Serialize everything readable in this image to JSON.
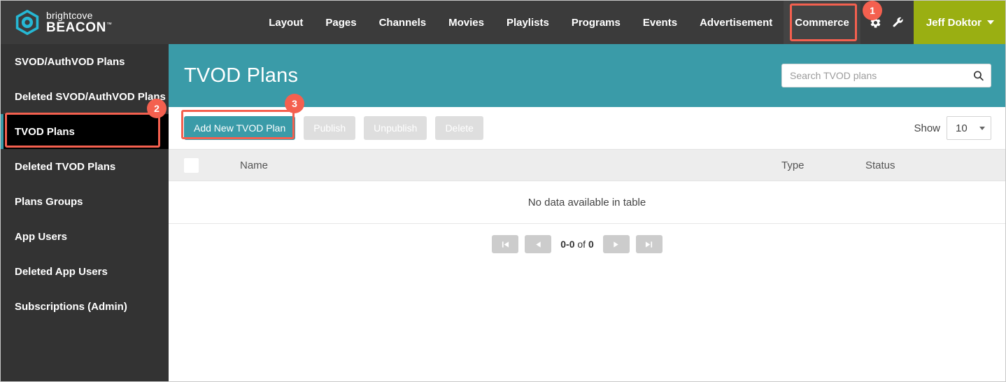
{
  "brand": {
    "top": "brightcove",
    "bottom": "BEACON",
    "trademark": "™",
    "logo_icon": "brightcove-hexagon-logo"
  },
  "topnav": {
    "items": [
      {
        "label": "Layout",
        "name": "nav-layout"
      },
      {
        "label": "Pages",
        "name": "nav-pages"
      },
      {
        "label": "Channels",
        "name": "nav-channels"
      },
      {
        "label": "Movies",
        "name": "nav-movies"
      },
      {
        "label": "Playlists",
        "name": "nav-playlists"
      },
      {
        "label": "Programs",
        "name": "nav-programs"
      },
      {
        "label": "Events",
        "name": "nav-events"
      },
      {
        "label": "Advertisement",
        "name": "nav-advertisement"
      },
      {
        "label": "Commerce",
        "name": "nav-commerce"
      }
    ],
    "gear_icon": "gear-icon",
    "wrench_icon": "wrench-icon",
    "user": "Jeff Doktor",
    "user_bg": "#9aaf12",
    "bar_bg": "#3b3b3b"
  },
  "sidebar": {
    "items": [
      {
        "label": "SVOD/AuthVOD Plans",
        "name": "sidebar-item-svod-authvod-plans",
        "active": false
      },
      {
        "label": "Deleted SVOD/AuthVOD Plans",
        "name": "sidebar-item-deleted-svod-authvod-plans",
        "active": false
      },
      {
        "label": "TVOD Plans",
        "name": "sidebar-item-tvod-plans",
        "active": true
      },
      {
        "label": "Deleted TVOD Plans",
        "name": "sidebar-item-deleted-tvod-plans",
        "active": false
      },
      {
        "label": "Plans Groups",
        "name": "sidebar-item-plans-groups",
        "active": false
      },
      {
        "label": "App Users",
        "name": "sidebar-item-app-users",
        "active": false
      },
      {
        "label": "Deleted App Users",
        "name": "sidebar-item-deleted-app-users",
        "active": false
      },
      {
        "label": "Subscriptions (Admin)",
        "name": "sidebar-item-subscriptions-admin",
        "active": false
      }
    ],
    "bg": "#333333",
    "active_bg": "#000000",
    "accent": "#3a9ba8"
  },
  "header": {
    "title": "TVOD Plans",
    "bg": "#3a9ba8"
  },
  "search": {
    "placeholder": "Search TVOD plans",
    "value": "",
    "icon": "search-icon"
  },
  "toolbar": {
    "add_label": "Add New TVOD Plan",
    "publish_label": "Publish",
    "unpublish_label": "Unpublish",
    "delete_label": "Delete",
    "show_label": "Show",
    "show_value": "10",
    "primary_color": "#3a9ba8",
    "disabled_color": "#dedede"
  },
  "table": {
    "columns": [
      "Name",
      "Type",
      "Status"
    ],
    "rows": [],
    "empty_message": "No data available in table"
  },
  "pagination": {
    "first_icon": "first-page-icon",
    "prev_icon": "previous-page-icon",
    "next_icon": "next-page-icon",
    "last_icon": "last-page-icon",
    "range": "0-0",
    "of": "of",
    "total": "0"
  },
  "annotations": {
    "badge1": "1",
    "badge2": "2",
    "badge3": "3",
    "color": "#f4604f"
  }
}
